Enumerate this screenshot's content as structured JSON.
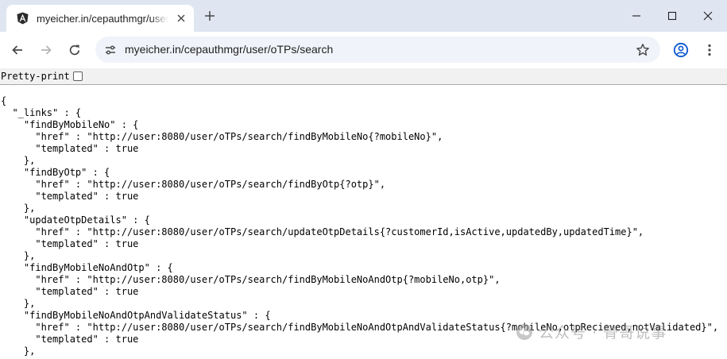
{
  "tab": {
    "title": "myeicher.in/cepauthmgr/user/oTPs/search",
    "favicon": "angular-icon"
  },
  "toolbar": {
    "url": "myeicher.in/cepauthmgr/user/oTPs/search"
  },
  "page": {
    "pretty_print_label": "Pretty-print",
    "pretty_print_checked": false,
    "json_lines": [
      "{",
      "  \"_links\" : {",
      "    \"findByMobileNo\" : {",
      "      \"href\" : \"http://user:8080/user/oTPs/search/findByMobileNo{?mobileNo}\",",
      "      \"templated\" : true",
      "    },",
      "    \"findByOtp\" : {",
      "      \"href\" : \"http://user:8080/user/oTPs/search/findByOtp{?otp}\",",
      "      \"templated\" : true",
      "    },",
      "    \"updateOtpDetails\" : {",
      "      \"href\" : \"http://user:8080/user/oTPs/search/updateOtpDetails{?customerId,isActive,updatedBy,updatedTime}\",",
      "      \"templated\" : true",
      "    },",
      "    \"findByMobileNoAndOtp\" : {",
      "      \"href\" : \"http://user:8080/user/oTPs/search/findByMobileNoAndOtp{?mobileNo,otp}\",",
      "      \"templated\" : true",
      "    },",
      "    \"findByMobileNoAndOtpAndValidateStatus\" : {",
      "      \"href\" : \"http://user:8080/user/oTPs/search/findByMobileNoAndOtpAndValidateStatus{?mobileNo,otpRecieved,notValidated}\",",
      "      \"templated\" : true",
      "    },"
    ]
  },
  "watermark": {
    "text": "公众号 · 骨哥说事"
  },
  "colors": {
    "tabstrip": "#dfe6f2",
    "omnibox": "#f0f3f9",
    "pretty_print_bar": "#f1f1f1",
    "icon": "#474747"
  }
}
